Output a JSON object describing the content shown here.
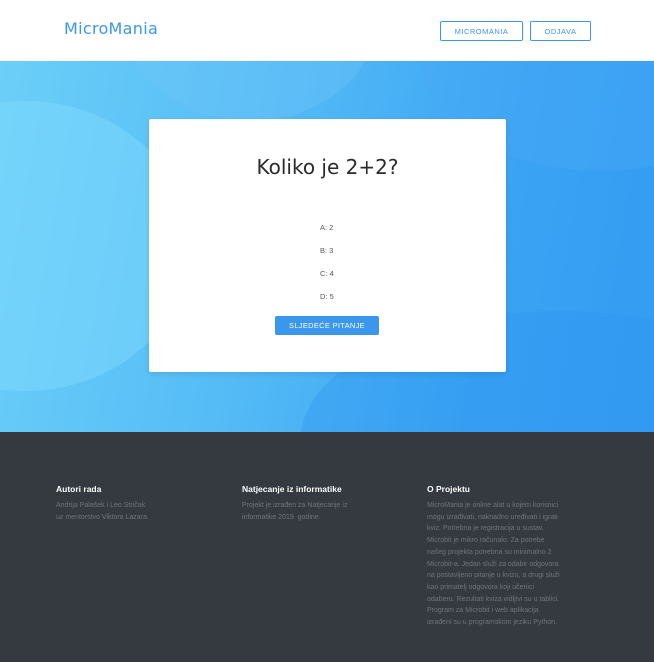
{
  "navbar": {
    "brand": "MicroMania",
    "buttons": {
      "micromania": "MICROMANIA",
      "odjava": "ODJAVA"
    }
  },
  "quiz": {
    "question": "Koliko je 2+2?",
    "answers": [
      "A: 2",
      "B: 3",
      "C: 4",
      "D: 5"
    ],
    "next_button": "SLJEDEĆE PITANJE"
  },
  "footer": {
    "authors": {
      "title": "Autori rada",
      "lines": [
        "Andrija Palašek i Leo Stričak",
        "uz mentorstvo Viktora Lazara."
      ]
    },
    "competition": {
      "title": "Natjecanje iz informatike",
      "lines": [
        "Projekt je izrađen za Natjecanje iz",
        "informatike 2019. godine."
      ]
    },
    "project": {
      "title": "O Projektu",
      "lines": [
        "MicroMania je online alat u kojem korisnici",
        "mogu izrađivati, naknadno uređivati i igrati",
        "kviz. Potrebna je registracija u sustav.",
        "Microbit je mikro računalo. Za potrebe",
        "našeg projekta potrebna su minimalno 2",
        "Microbit-a. Jedan služi za odabir odgovora",
        "na postavljeno pitanje u kvizu, a drugi služi",
        "kao primatelj odgovora koji učenici",
        "odaberu. Rezultati kviza vidljivi su u tablici.",
        "Program za Microbit i web aplikacija",
        "izrađeni su u programskom jeziku Python."
      ]
    }
  }
}
